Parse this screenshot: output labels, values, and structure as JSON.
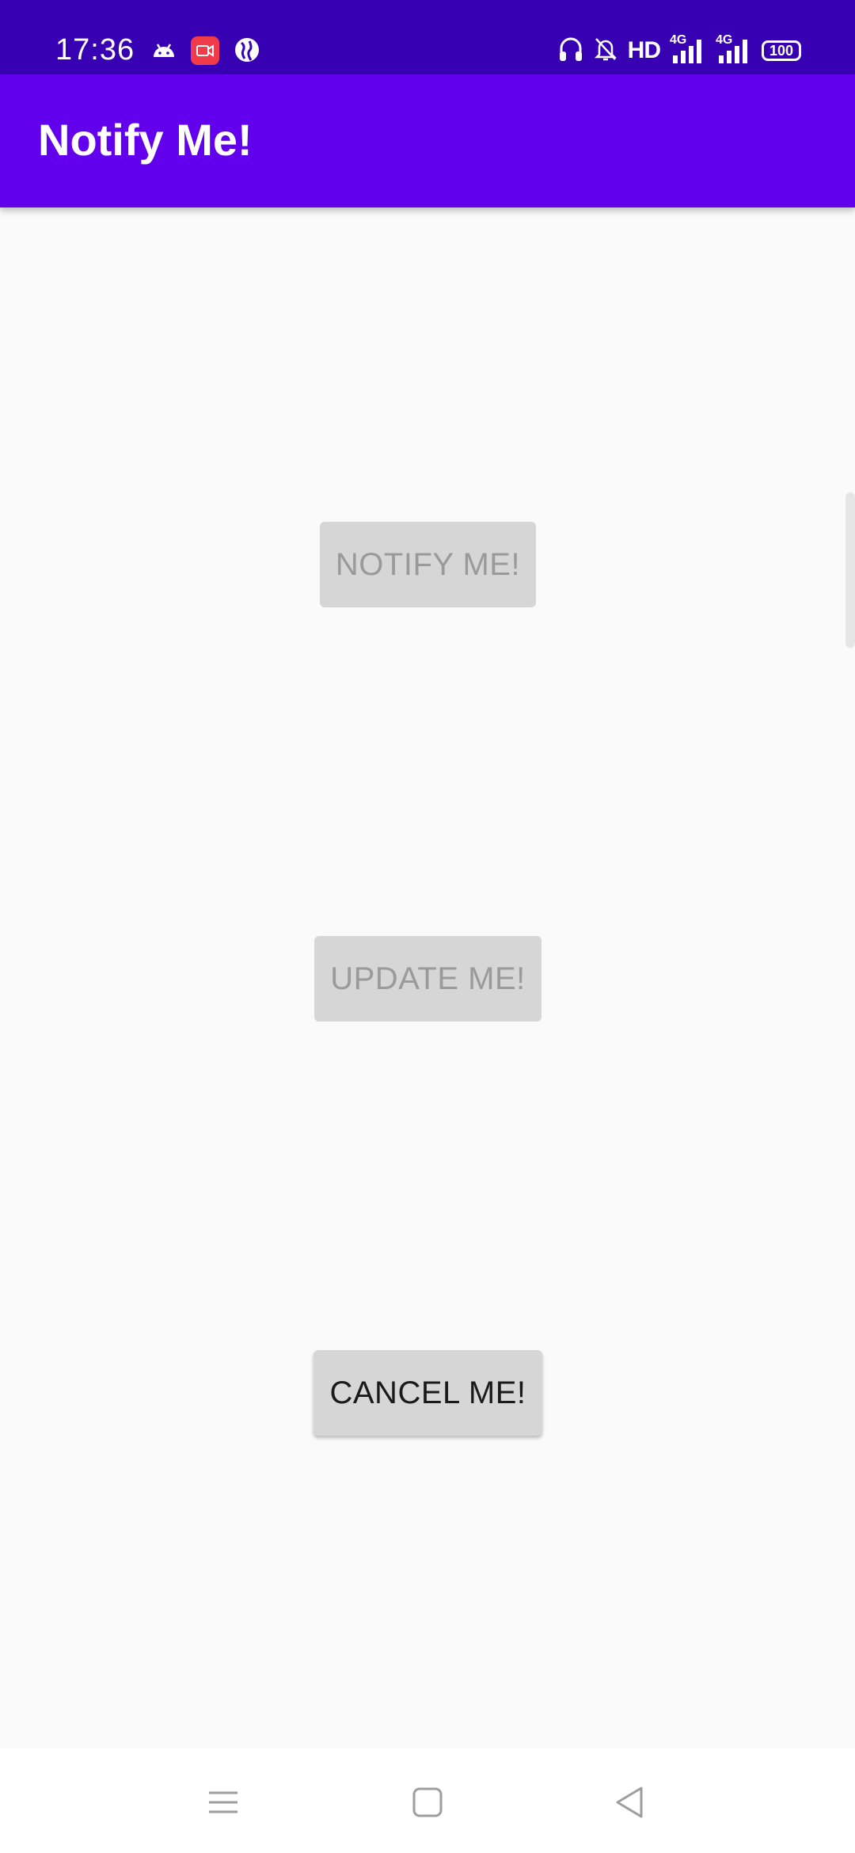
{
  "status_bar": {
    "time": "17:36",
    "left_icons": [
      "android-icon",
      "screen-record-icon",
      "globe-icon"
    ],
    "right_icons": [
      "headphones-icon",
      "bell-muted-icon",
      "hd-icon",
      "signal-4g-icon",
      "signal-4g-icon",
      "battery-icon"
    ],
    "hd_label": "HD",
    "network_label_1": "4G",
    "network_label_2": "4G",
    "battery_level": "100"
  },
  "app_bar": {
    "title": "Notify Me!",
    "color": "#6200EE"
  },
  "buttons": {
    "notify": {
      "label": "NOTIFY ME!",
      "enabled": false
    },
    "update": {
      "label": "UPDATE ME!",
      "enabled": false
    },
    "cancel": {
      "label": "CANCEL ME!",
      "enabled": true
    }
  },
  "nav_bar": {
    "items": [
      "menu-icon",
      "home-icon",
      "back-icon"
    ]
  },
  "colors": {
    "status_bar": "#3700B3",
    "primary": "#6200EE",
    "background": "#FAFAFA",
    "button": "#D6D6D6"
  }
}
